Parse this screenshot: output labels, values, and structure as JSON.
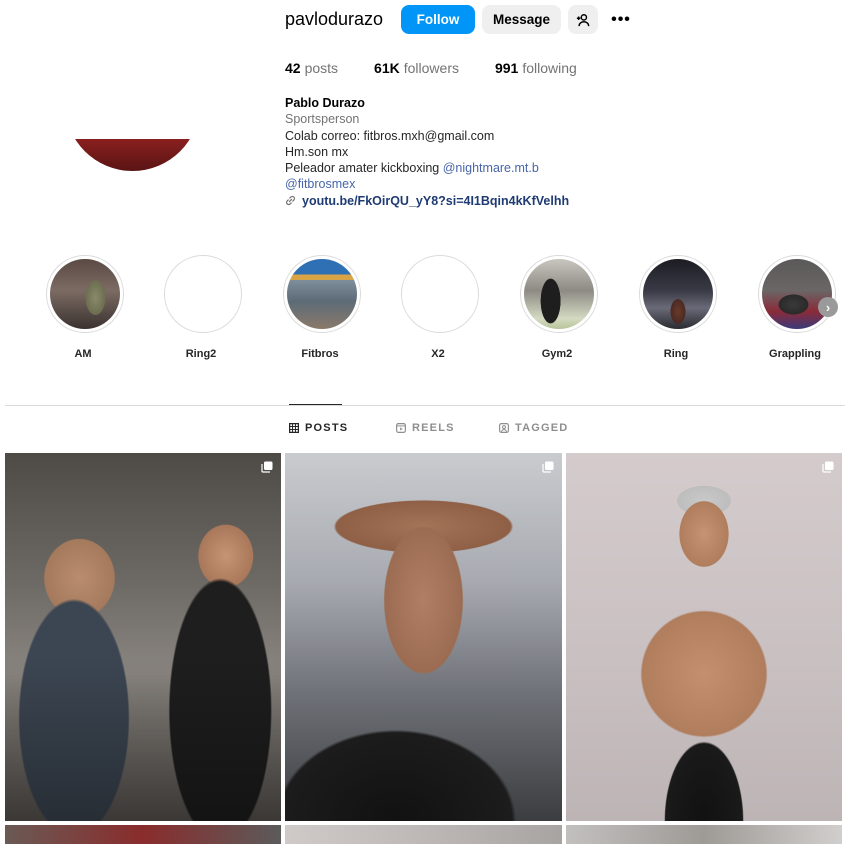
{
  "profile": {
    "username": "pavlodurazo",
    "follow_label": "Follow",
    "message_label": "Message",
    "more_label": "•••"
  },
  "stats": {
    "posts_count": "42",
    "posts_label": "posts",
    "followers_count": "61K",
    "followers_label": "followers",
    "following_count": "991",
    "following_label": "following"
  },
  "bio": {
    "name": "Pablo Durazo",
    "category": "Sportsperson",
    "line1": "Colab correo: fitbros.mxh@gmail.com",
    "line2": "Hm.son mx",
    "line3_text": "Peleador amater kickboxing ",
    "line3_mention": "@nightmare.mt.b",
    "line4_mention": "@fitbrosmex",
    "link": "youtu.be/FkOirQU_yY8?si=4I1Bqin4kKfVelhh"
  },
  "highlights": [
    {
      "label": "AM"
    },
    {
      "label": "Ring2"
    },
    {
      "label": "Fitbros"
    },
    {
      "label": "X2"
    },
    {
      "label": "Gym2"
    },
    {
      "label": "Ring"
    },
    {
      "label": "Grappling"
    }
  ],
  "tabs": {
    "posts": "POSTS",
    "reels": "REELS",
    "tagged": "TAGGED"
  },
  "colors": {
    "accent": "#0095f6",
    "mention": "#4765a8"
  },
  "icons": {
    "add_user": "add-user-icon",
    "more": "more-icon",
    "link": "link-icon",
    "grid": "grid-icon",
    "reels": "reels-icon",
    "tagged": "tagged-icon",
    "multi": "multiple-posts-icon",
    "next": "chevron-right-icon"
  }
}
